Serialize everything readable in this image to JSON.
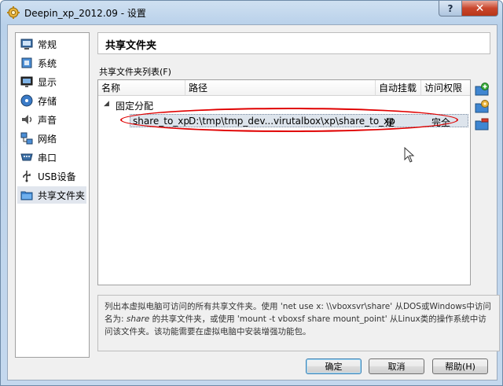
{
  "window": {
    "title": "Deepin_xp_2012.09 - 设置",
    "help_button": "?",
    "close_button": "✕"
  },
  "sidebar": {
    "items": [
      {
        "label": "常规",
        "icon": "general-icon"
      },
      {
        "label": "系统",
        "icon": "system-icon"
      },
      {
        "label": "显示",
        "icon": "display-icon"
      },
      {
        "label": "存储",
        "icon": "storage-icon"
      },
      {
        "label": "声音",
        "icon": "audio-icon"
      },
      {
        "label": "网络",
        "icon": "network-icon"
      },
      {
        "label": "串口",
        "icon": "serial-port-icon"
      },
      {
        "label": "USB设备",
        "icon": "usb-icon"
      },
      {
        "label": "共享文件夹",
        "icon": "shared-folder-icon",
        "selected": true
      }
    ]
  },
  "main": {
    "title": "共享文件夹",
    "list_label": "共享文件夹列表(F)",
    "columns": [
      "名称",
      "路径",
      "自动挂载",
      "访问权限"
    ],
    "group": {
      "label": "固定分配"
    },
    "rows": [
      {
        "name": "share_to_xp",
        "path": "D:\\tmp\\tmp_dev...virutalbox\\xp\\share_to_xp",
        "auto_mount": "是",
        "access": "完全"
      }
    ],
    "description_parts": {
      "p1": "列出本虚拟电脑可访问的所有共享文件夹。使用 'net use x: \\\\vboxsvr\\share' 从DOS或Windows中访问名为: ",
      "em1": "share",
      "p2": " 的共享文件夹，或使用 'mount -t vboxsf share mount_point' 从Linux类的操作系统中访问该文件夹。该功能需要在虚拟电脑中安装增强功能包。"
    }
  },
  "buttons": {
    "ok": "确定",
    "cancel": "取消",
    "help": "帮助(H)"
  },
  "colors": {
    "title_bar": "#c4d8ee",
    "selection": "#dde4ec",
    "highlight_ellipse": "#e00000",
    "close_button": "#c9462c"
  }
}
